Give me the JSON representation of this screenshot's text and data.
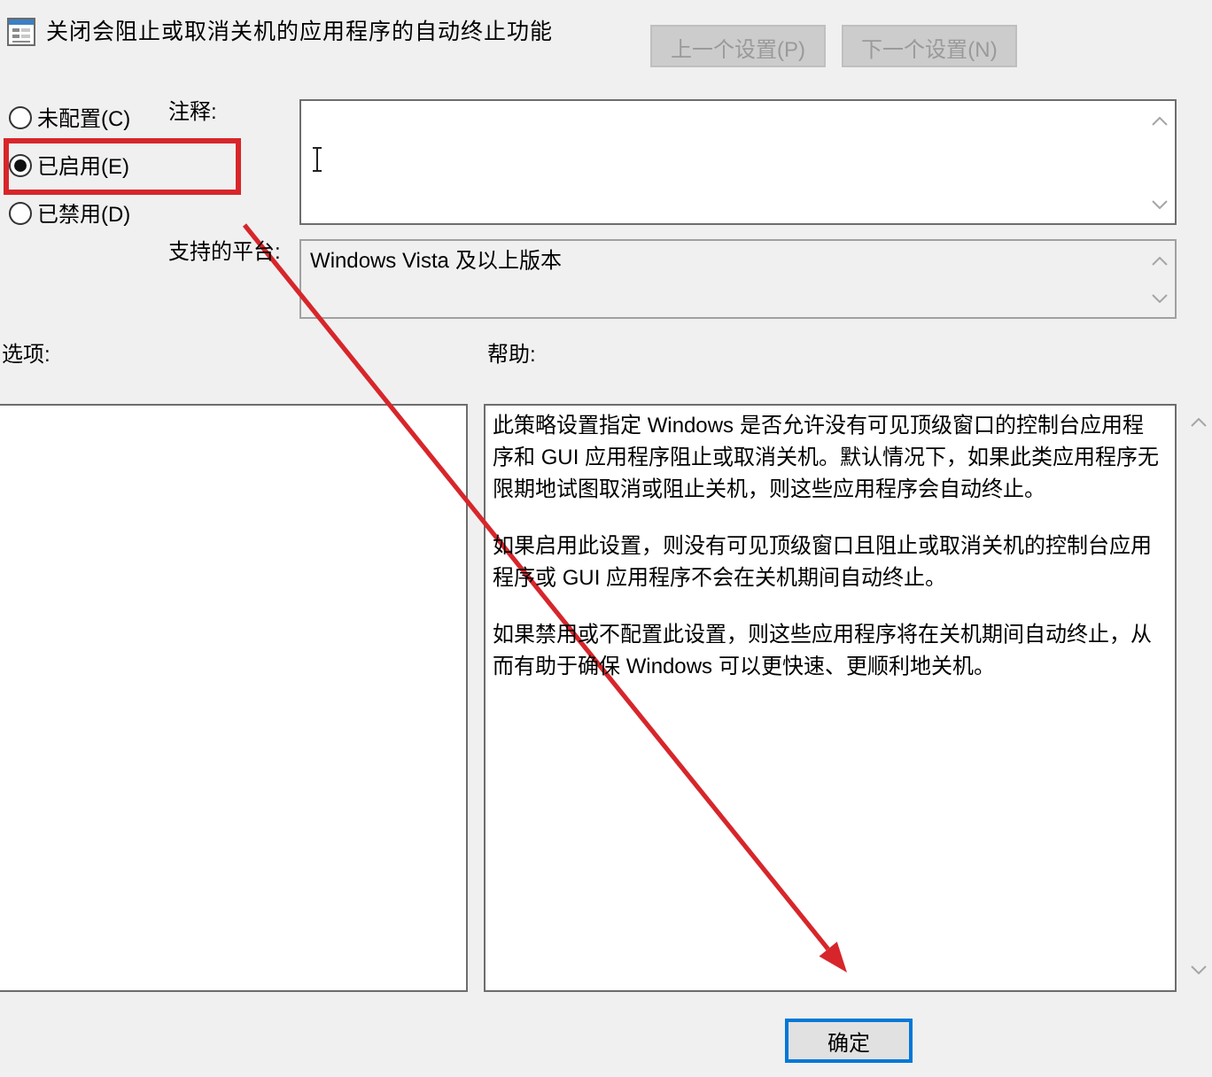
{
  "window": {
    "title": "关闭会阻止或取消关机的应用程序的自动终止功能"
  },
  "nav_buttons": [
    {
      "label": "上一个设置(P)",
      "disabled": true
    },
    {
      "label": "下一个设置(N)",
      "disabled": true
    }
  ],
  "state_options": [
    {
      "label": "未配置(C)",
      "selected": false,
      "highlighted": false
    },
    {
      "label": "已启用(E)",
      "selected": true,
      "highlighted": true
    },
    {
      "label": "已禁用(D)",
      "selected": false,
      "highlighted": false
    }
  ],
  "comment": {
    "label": "注释:"
  },
  "supported_on": {
    "label": "支持的平台:",
    "value": "Windows Vista 及以上版本"
  },
  "options": {
    "label": "选项:"
  },
  "help": {
    "label": "帮助:",
    "paragraphs": [
      "此策略设置指定 Windows 是否允许没有可见顶级窗口的控制台应用程序和 GUI 应用程序阻止或取消关机。默认情况下，如果此类应用程序无限期地试图取消或阻止关机，则这些应用程序会自动终止。",
      "如果启用此设置，则没有可见顶级窗口且阻止或取消关机的控制台应用程序或 GUI 应用程序不会在关机期间自动终止。",
      "如果禁用或不配置此设置，则这些应用程序将在关机期间自动终止，从而有助于确保 Windows 可以更快速、更顺利地关机。"
    ]
  },
  "buttons": [
    {
      "label": "确定",
      "default": true
    }
  ],
  "annotations": [
    {
      "kind": "arrow"
    }
  ]
}
